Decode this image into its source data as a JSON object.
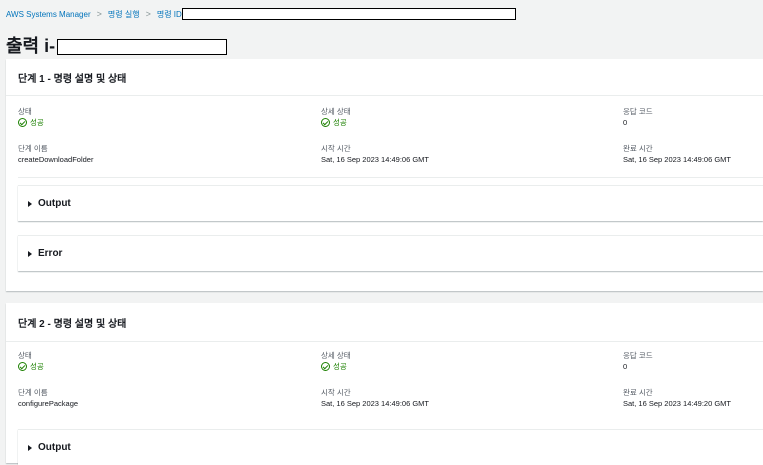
{
  "breadcrumb": [
    "AWS Systems Manager",
    "명령 실행",
    "명령 ID"
  ],
  "separator": ">",
  "page_title": "출력 i-",
  "steps": [
    {
      "header": "단계 1 - 명령 설명 및 상태",
      "status_label": "상태",
      "status_value": "성공",
      "detail_status_label": "상세 상태",
      "detail_status_value": "성공",
      "response_code_label": "응답 코드",
      "response_code_value": "0",
      "step_name_label": "단계 이름",
      "step_name_value": "createDownloadFolder",
      "start_time_label": "시작 시간",
      "start_time_value": "Sat, 16 Sep 2023 14:49:06 GMT",
      "end_time_label": "완료 시간",
      "end_time_value": "Sat, 16 Sep 2023 14:49:06 GMT",
      "output_label": "Output",
      "error_label": "Error"
    },
    {
      "header": "단계 2 - 명령 설명 및 상태",
      "status_label": "상태",
      "status_value": "성공",
      "detail_status_label": "상세 상태",
      "detail_status_value": "성공",
      "response_code_label": "응답 코드",
      "response_code_value": "0",
      "step_name_label": "단계 이름",
      "step_name_value": "configurePackage",
      "start_time_label": "시작 시간",
      "start_time_value": "Sat, 16 Sep 2023 14:49:06 GMT",
      "end_time_label": "완료 시간",
      "end_time_value": "Sat, 16 Sep 2023 14:49:20 GMT",
      "output_label": "Output"
    }
  ],
  "icons": {
    "status": "check-circle-icon",
    "expand": "caret-right-icon"
  },
  "colors": {
    "link": "#0073bb",
    "success": "#1d8102",
    "background": "#f2f3f3"
  }
}
